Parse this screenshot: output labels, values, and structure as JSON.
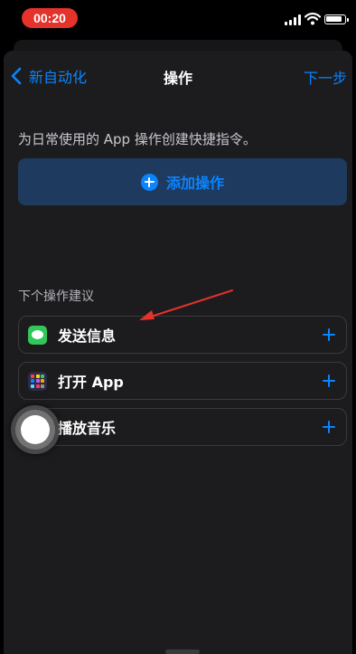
{
  "status_bar": {
    "time": "00:20",
    "signal_icon": "cellular-signal-icon",
    "wifi_icon": "wifi-icon",
    "battery_icon": "battery-icon"
  },
  "nav": {
    "back_label": "新自动化",
    "title": "操作",
    "next_label": "下一步"
  },
  "intro_text": "为日常使用的 App 操作创建快捷指令。",
  "add_action": {
    "label": "添加操作",
    "icon": "plus-circle-icon"
  },
  "suggestions": {
    "header": "下个操作建议",
    "items": [
      {
        "label": "发送信息",
        "icon": "messages-app-icon"
      },
      {
        "label": "打开 App",
        "icon": "apps-grid-icon"
      },
      {
        "label": "播放音乐",
        "icon": "music-app-icon"
      }
    ]
  },
  "annotation": {
    "arrow_color": "#e5322b"
  },
  "colors": {
    "accent": "#0a84ff",
    "background": "#1c1c1e",
    "time_pill": "#e5322b"
  }
}
